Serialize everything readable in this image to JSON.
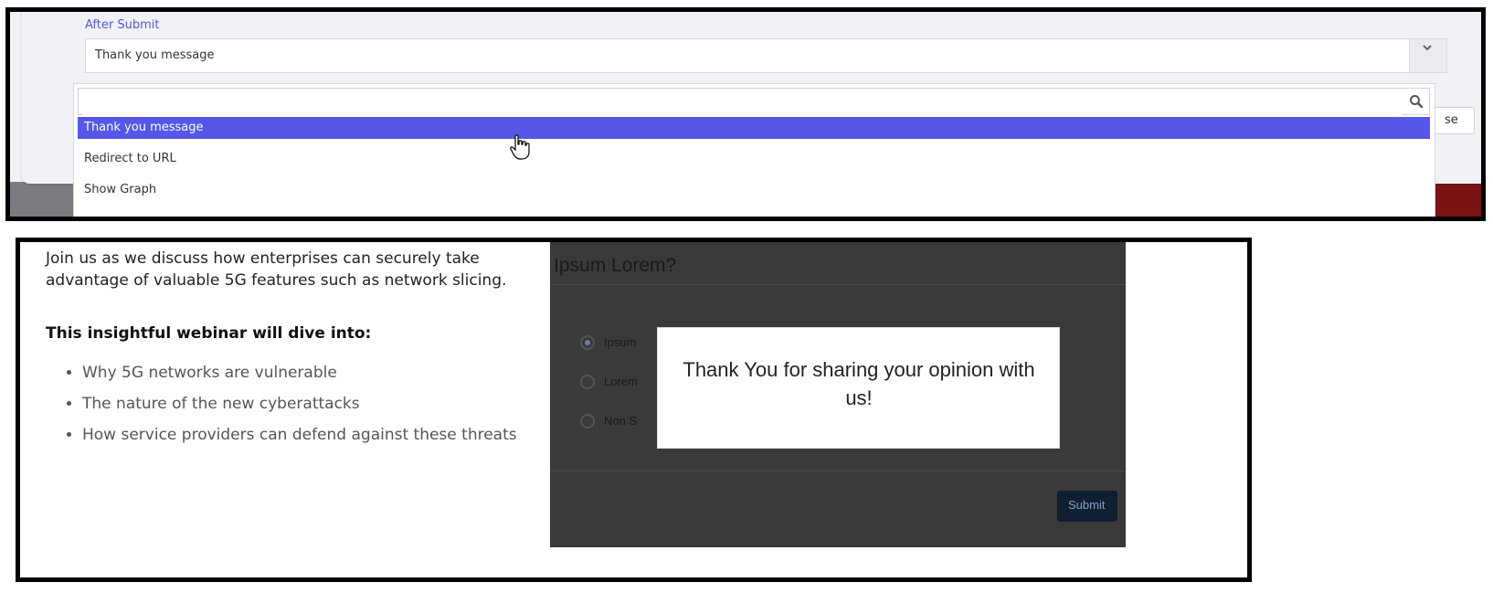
{
  "after_submit": {
    "label": "After Submit",
    "selected_value": "Thank you message",
    "search_placeholder": "",
    "options": [
      "Thank you message",
      "Redirect to URL",
      "Show Graph"
    ],
    "close_label": "se",
    "highlight_color": "#5457e8"
  },
  "webinar": {
    "intro": "Join us as we discuss how enterprises can securely take advantage of valuable 5G features such as network slicing.",
    "dive_heading": "This insightful webinar will dive into:",
    "bullets": [
      "Why 5G networks are vulnerable",
      "The nature of the new cyberattacks",
      "How service providers can defend against these threats"
    ]
  },
  "poll": {
    "title": "Ipsum Lorem?",
    "options": [
      "Ipsum",
      "Lorem",
      "Non S"
    ],
    "submit_label": "Submit",
    "thank_you": "Thank You for sharing your opinion with us!"
  }
}
